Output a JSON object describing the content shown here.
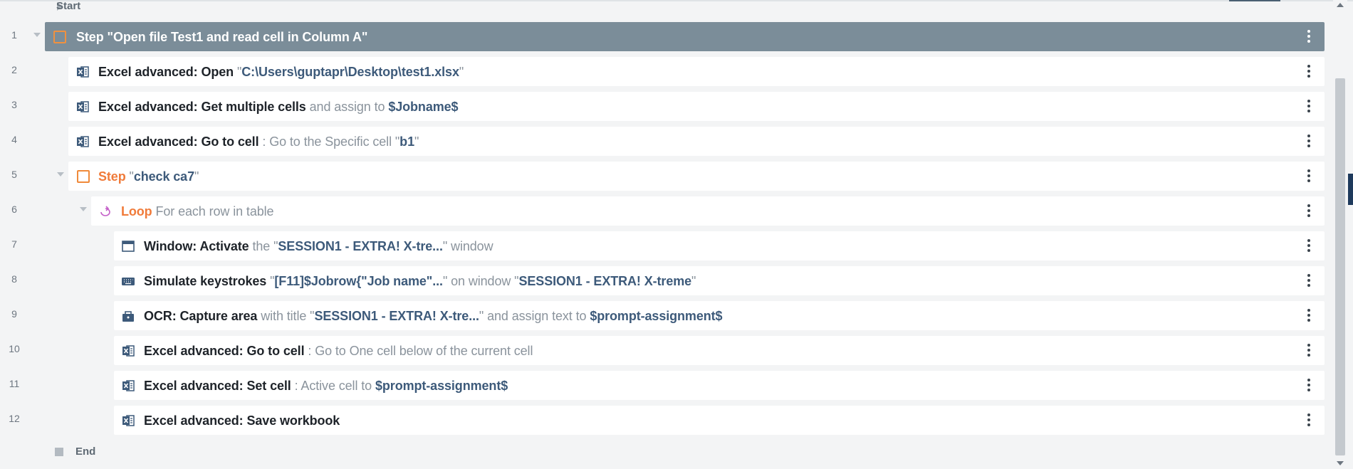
{
  "flow": {
    "start_label": "Start",
    "end_label": "End",
    "rows": [
      {
        "num": "1",
        "type": "step-head",
        "parts": [
          {
            "t": "Step ",
            "c": "white"
          },
          {
            "t": "\"Open file Test1 and read cell in Column A\"",
            "c": "white"
          }
        ]
      },
      {
        "num": "2",
        "icon": "excel-icon",
        "parts": [
          {
            "t": "Excel advanced: Open ",
            "c": "cmd"
          },
          {
            "t": "\"",
            "c": "muted"
          },
          {
            "t": "C:\\Users\\guptapr\\Desktop\\test1.xlsx",
            "c": "val"
          },
          {
            "t": "\"",
            "c": "muted"
          }
        ]
      },
      {
        "num": "3",
        "icon": "excel-icon",
        "parts": [
          {
            "t": "Excel advanced: Get multiple cells ",
            "c": "cmd"
          },
          {
            "t": "and assign to ",
            "c": "muted"
          },
          {
            "t": "$Jobname$",
            "c": "val"
          }
        ]
      },
      {
        "num": "4",
        "icon": "excel-icon",
        "parts": [
          {
            "t": "Excel advanced: Go to cell ",
            "c": "cmd"
          },
          {
            "t": ": Go to the Specific cell \"",
            "c": "muted"
          },
          {
            "t": "b1",
            "c": "val"
          },
          {
            "t": "\"",
            "c": "muted"
          }
        ]
      },
      {
        "num": "5",
        "type": "step",
        "parts": [
          {
            "t": "Step ",
            "c": "orange"
          },
          {
            "t": "\"",
            "c": "muted"
          },
          {
            "t": "check ca7",
            "c": "val"
          },
          {
            "t": "\"",
            "c": "muted"
          }
        ]
      },
      {
        "num": "6",
        "icon": "loop-icon",
        "parts": [
          {
            "t": "Loop ",
            "c": "orange"
          },
          {
            "t": "For each row in table",
            "c": "muted"
          }
        ]
      },
      {
        "num": "7",
        "icon": "window-icon",
        "parts": [
          {
            "t": "Window: Activate ",
            "c": "cmd"
          },
          {
            "t": "the \"",
            "c": "muted"
          },
          {
            "t": "SESSION1 - EXTRA! X-tre...",
            "c": "val"
          },
          {
            "t": "\" window",
            "c": "muted"
          }
        ]
      },
      {
        "num": "8",
        "icon": "keyboard-icon",
        "parts": [
          {
            "t": "Simulate keystrokes ",
            "c": "cmd"
          },
          {
            "t": "\"",
            "c": "muted"
          },
          {
            "t": "[F11]$Jobrow{\"Job name\"...",
            "c": "val"
          },
          {
            "t": "\" on window \"",
            "c": "muted"
          },
          {
            "t": "SESSION1 - EXTRA! X-treme",
            "c": "val"
          },
          {
            "t": "\"",
            "c": "muted"
          }
        ]
      },
      {
        "num": "9",
        "icon": "ocr-icon",
        "parts": [
          {
            "t": "OCR: Capture area ",
            "c": "cmd"
          },
          {
            "t": "with title \"",
            "c": "muted"
          },
          {
            "t": "SESSION1 - EXTRA! X-tre...",
            "c": "val"
          },
          {
            "t": "\" and assign text to ",
            "c": "muted"
          },
          {
            "t": "$prompt-assignment$",
            "c": "val"
          }
        ]
      },
      {
        "num": "10",
        "icon": "excel-icon",
        "parts": [
          {
            "t": "Excel advanced: Go to cell ",
            "c": "cmd"
          },
          {
            "t": ": Go to One cell below of the current cell",
            "c": "muted"
          }
        ]
      },
      {
        "num": "11",
        "icon": "excel-icon",
        "parts": [
          {
            "t": "Excel advanced: Set cell ",
            "c": "cmd"
          },
          {
            "t": ": Active cell to ",
            "c": "muted"
          },
          {
            "t": "$prompt-assignment$",
            "c": "val"
          }
        ]
      },
      {
        "num": "12",
        "icon": "excel-icon",
        "parts": [
          {
            "t": "Excel advanced: Save workbook",
            "c": "cmd"
          }
        ]
      }
    ]
  }
}
